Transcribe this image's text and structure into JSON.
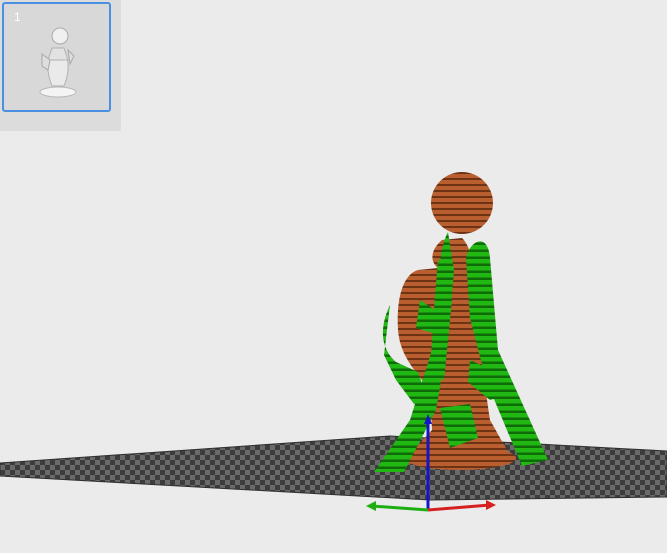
{
  "plates": [
    {
      "label": "1",
      "selected": true
    }
  ],
  "colors": {
    "background": "#ebebeb",
    "plate_panel": "#dcdcdc",
    "selection_border": "#4a90e2",
    "model_brown": "#b25a2c",
    "support_green": "#1fae12",
    "bed_grid": "#5a5a5a",
    "axis_x": "#d62020",
    "axis_y": "#1fae12",
    "axis_z": "#1515c8"
  },
  "icons": {
    "thumbnail": "figurine-thumbnail-icon"
  }
}
